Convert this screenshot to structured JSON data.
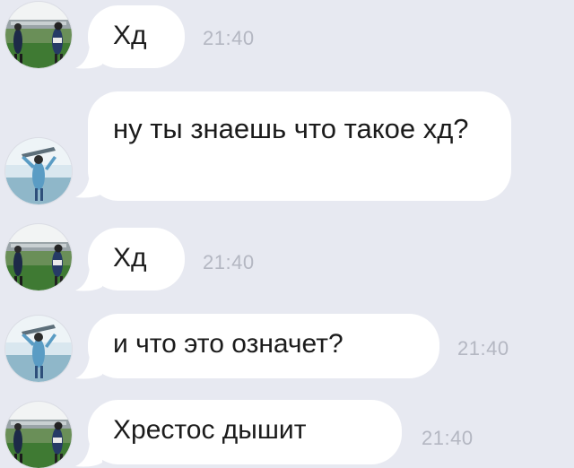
{
  "messages": [
    {
      "text": "Хд",
      "time": "21:40",
      "avatar": "user-a-avatar"
    },
    {
      "text": "ну ты знаешь что такое хд?",
      "time": "",
      "avatar": "user-b-avatar"
    },
    {
      "text": "Хд",
      "time": "21:40",
      "avatar": "user-a-avatar"
    },
    {
      "text": "и что это означет?",
      "time": "21:40",
      "avatar": "user-b-avatar"
    },
    {
      "text": "Хрестос дышит",
      "time": "21:40",
      "avatar": "user-a-avatar"
    }
  ],
  "colors": {
    "background": "#e7e9f1",
    "bubble": "#ffffff",
    "text": "#1b1b1b",
    "time": "#b4b7c2"
  }
}
